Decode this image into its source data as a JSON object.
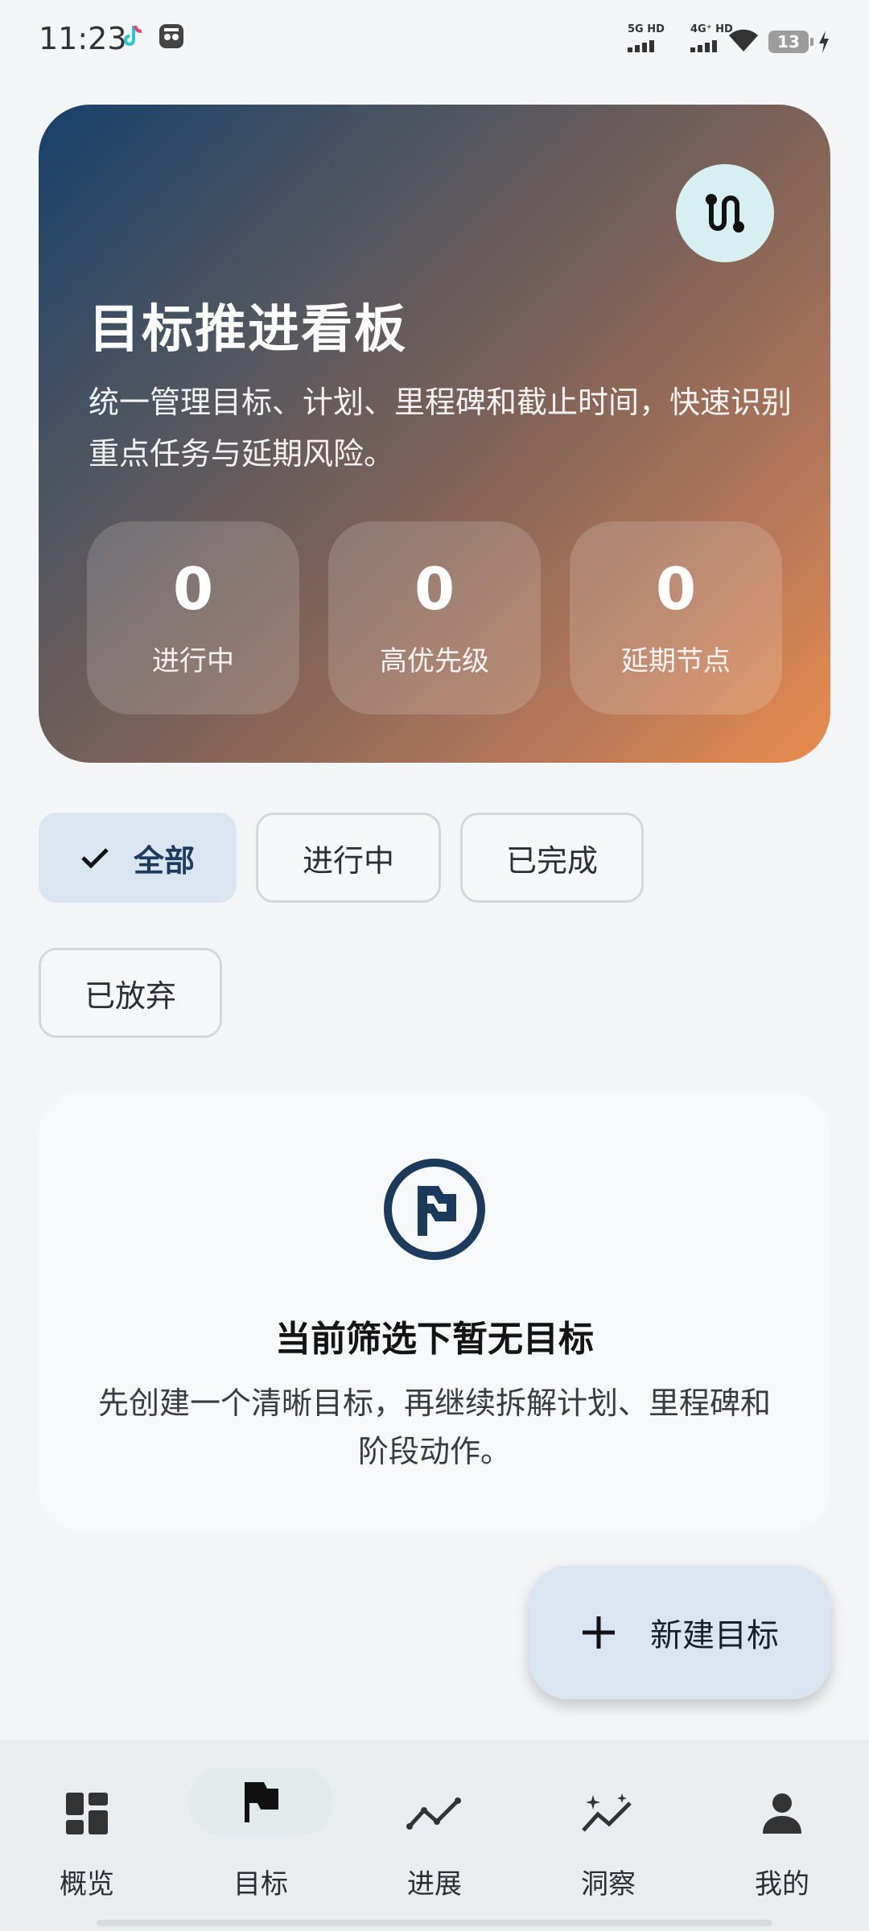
{
  "status_bar": {
    "time": "11:23",
    "signal1": "5G HD",
    "signal2": "4G⁺ HD",
    "battery": "13"
  },
  "hero": {
    "title": "目标推进看板",
    "subtitle": "统一管理目标、计划、里程碑和截止时间，快速识别重点任务与延期风险。",
    "stats": [
      {
        "value": "0",
        "label": "进行中"
      },
      {
        "value": "0",
        "label": "高优先级"
      },
      {
        "value": "0",
        "label": "延期节点"
      }
    ]
  },
  "filters": [
    {
      "label": "全部",
      "selected": true
    },
    {
      "label": "进行中",
      "selected": false
    },
    {
      "label": "已完成",
      "selected": false
    },
    {
      "label": "已放弃",
      "selected": false
    }
  ],
  "empty_state": {
    "title": "当前筛选下暂无目标",
    "description": "先创建一个清晰目标，再继续拆解计划、里程碑和阶段动作。"
  },
  "fab": {
    "label": "新建目标"
  },
  "nav": [
    {
      "label": "概览",
      "icon": "dashboard-icon"
    },
    {
      "label": "目标",
      "icon": "flag-icon",
      "active": true
    },
    {
      "label": "进展",
      "icon": "trend-icon"
    },
    {
      "label": "洞察",
      "icon": "sparkle-icon"
    },
    {
      "label": "我的",
      "icon": "person-icon"
    }
  ],
  "colors": {
    "accent": "#17406a",
    "chip_active_bg": "#d9e6f1",
    "hero_gradient_start": "#17406a",
    "hero_gradient_end": "#ea8c4c"
  }
}
